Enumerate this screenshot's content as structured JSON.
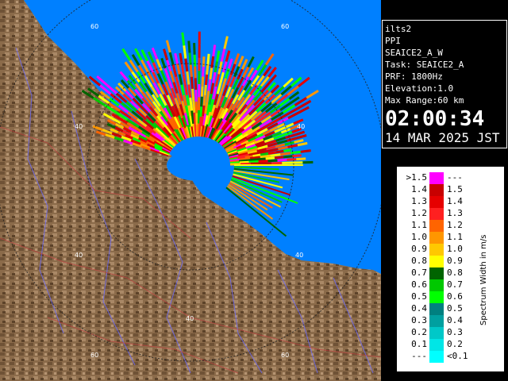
{
  "info": {
    "station": "ilts2",
    "mode": "PPI",
    "product": "SEAICE2_A_W",
    "task": "Task: SEAICE2_A",
    "prf": "PRF: 1800Hz",
    "elevation": "Elevation:1.0",
    "max_range": "Max Range:60 km",
    "time": "02:00:34",
    "date": "14 MAR 2025 JST"
  },
  "map": {
    "ring_labels": [
      "60",
      "60",
      "40",
      "40",
      "40",
      "40",
      "60",
      "60"
    ],
    "colors": {
      "sea": "#0080ff",
      "land": "#8b6b4a",
      "rings": "#1a1a1a"
    }
  },
  "legend": {
    "title": "Spectrum Width in m/s",
    "rows": [
      {
        "low": ">1.5",
        "high": "---",
        "color": "#ff00ff"
      },
      {
        "low": "1.4",
        "high": "1.5",
        "color": "#c80000"
      },
      {
        "low": "1.3",
        "high": "1.4",
        "color": "#e60000"
      },
      {
        "low": "1.2",
        "high": "1.3",
        "color": "#ff2020"
      },
      {
        "low": "1.1",
        "high": "1.2",
        "color": "#ff6400"
      },
      {
        "low": "1.0",
        "high": "1.1",
        "color": "#ff9600"
      },
      {
        "low": "0.9",
        "high": "1.0",
        "color": "#ffc800"
      },
      {
        "low": "0.8",
        "high": "0.9",
        "color": "#ffff00"
      },
      {
        "low": "0.7",
        "high": "0.8",
        "color": "#006400"
      },
      {
        "low": "0.6",
        "high": "0.7",
        "color": "#00c800"
      },
      {
        "low": "0.5",
        "high": "0.6",
        "color": "#00ff00"
      },
      {
        "low": "0.4",
        "high": "0.5",
        "color": "#008080"
      },
      {
        "low": "0.3",
        "high": "0.4",
        "color": "#00a0a0"
      },
      {
        "low": "0.2",
        "high": "0.3",
        "color": "#00c8c8"
      },
      {
        "low": "0.1",
        "high": "0.2",
        "color": "#00e6e6"
      },
      {
        "low": "---",
        "high": "<0.1",
        "color": "#00ffff"
      }
    ]
  }
}
